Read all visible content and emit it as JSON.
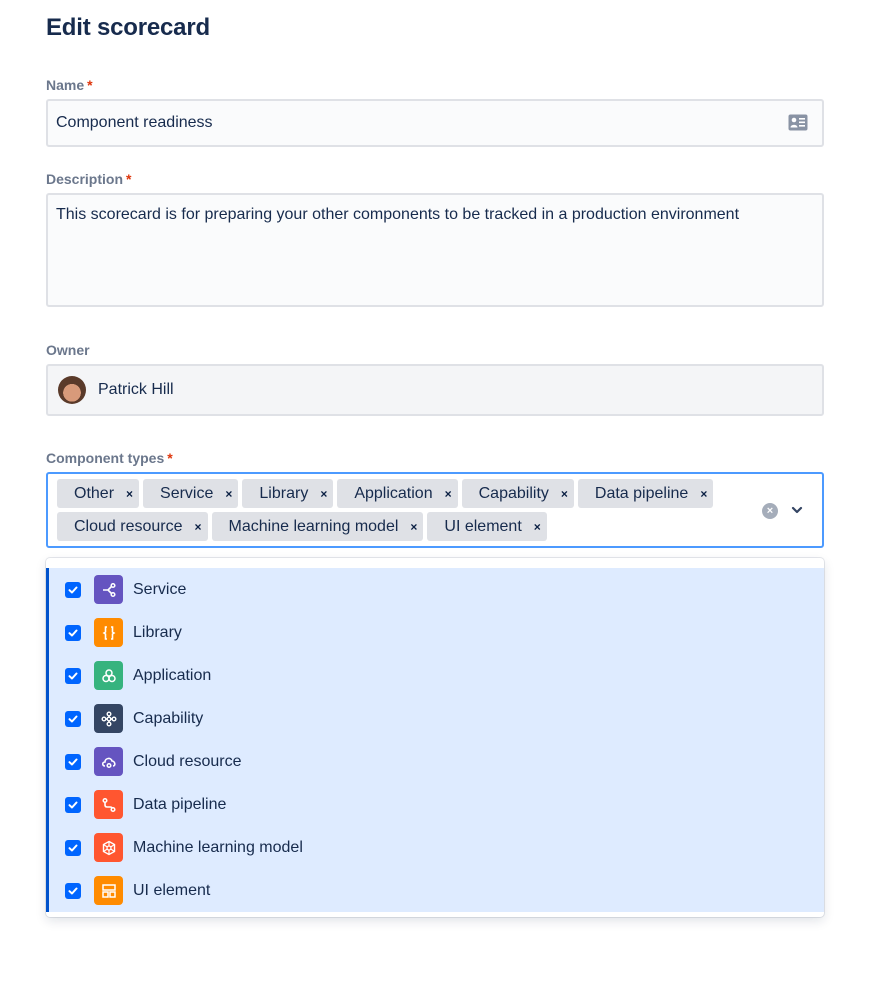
{
  "page": {
    "title": "Edit scorecard"
  },
  "form": {
    "name": {
      "label": "Name",
      "required_mark": "*",
      "value": "Component readiness",
      "icon": "contact-card-icon"
    },
    "description": {
      "label": "Description",
      "required_mark": "*",
      "value": "This scorecard is for preparing your other components to be tracked in a production environment"
    },
    "owner": {
      "label": "Owner",
      "value": "Patrick Hill"
    },
    "component_types": {
      "label": "Component types",
      "required_mark": "*",
      "remove_glyph": "×",
      "clear_glyph": "×",
      "selected": [
        "Other",
        "Service",
        "Library",
        "Application",
        "Capability",
        "Data pipeline",
        "Cloud resource",
        "Machine learning model",
        "UI element"
      ],
      "options": [
        {
          "label": "Service",
          "checked": true,
          "icon": "service-icon",
          "color": "#6554C0"
        },
        {
          "label": "Library",
          "checked": true,
          "icon": "library-icon",
          "color": "#FF8B00"
        },
        {
          "label": "Application",
          "checked": true,
          "icon": "application-icon",
          "color": "#36B37E"
        },
        {
          "label": "Capability",
          "checked": true,
          "icon": "capability-icon",
          "color": "#344563"
        },
        {
          "label": "Cloud resource",
          "checked": true,
          "icon": "cloud-resource-icon",
          "color": "#6554C0"
        },
        {
          "label": "Data pipeline",
          "checked": true,
          "icon": "data-pipeline-icon",
          "color": "#FF5630"
        },
        {
          "label": "Machine learning model",
          "checked": true,
          "icon": "ml-model-icon",
          "color": "#FF5630"
        },
        {
          "label": "UI element",
          "checked": true,
          "icon": "ui-element-icon",
          "color": "#FF8B00"
        }
      ]
    }
  },
  "colors": {
    "accent": "#0065FF",
    "focus_border": "#4C9AFF",
    "selected_bg": "#DEEBFF",
    "required": "#DE350B"
  }
}
